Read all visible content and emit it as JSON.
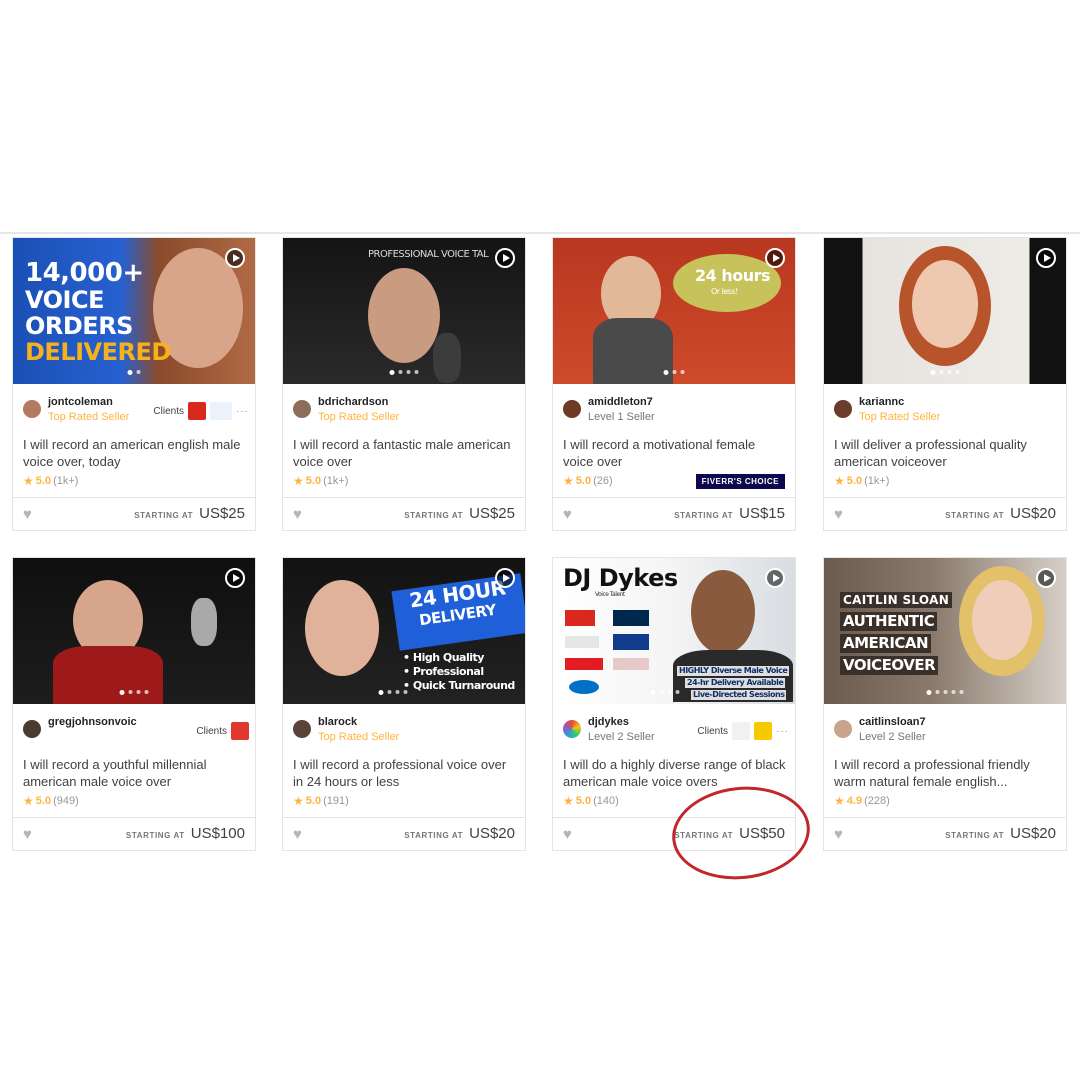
{
  "gigs": [
    {
      "username": "jontcoleman",
      "level": "Top Rated Seller",
      "clients_label": "Clients",
      "title": "I will record an american english male voice over, today",
      "rating": "5.0",
      "reviews": "(1k+)",
      "starting_label": "STARTING AT",
      "price": "US$25",
      "thumb_lines": [
        "14,000+",
        "VOICE",
        "ORDERS",
        "DELIVERED"
      ]
    },
    {
      "username": "bdrichardson",
      "level": "Top Rated Seller",
      "title": "I will record a fantastic male american voice over",
      "rating": "5.0",
      "reviews": "(1k+)",
      "starting_label": "STARTING AT",
      "price": "US$25",
      "thumb_lines": [
        "PROFESSIONAL VOICE TAL"
      ]
    },
    {
      "username": "amiddleton7",
      "level": "Level 1 Seller",
      "title": "I will record a motivational female voice over",
      "rating": "5.0",
      "reviews": "(26)",
      "badge": "FIVERR'S CHOICE",
      "starting_label": "STARTING AT",
      "price": "US$15",
      "thumb_lines": [
        "24 hours",
        "Or less!"
      ]
    },
    {
      "username": "kariannc",
      "level": "Top Rated Seller",
      "title": "I will deliver a professional quality american voiceover",
      "rating": "5.0",
      "reviews": "(1k+)",
      "starting_label": "STARTING AT",
      "price": "US$20"
    },
    {
      "username": "gregjohnsonvoic",
      "level": "",
      "clients_label": "Clients",
      "title": "I will record a youthful millennial american male voice over",
      "rating": "5.0",
      "reviews": "(949)",
      "starting_label": "STARTING AT",
      "price": "US$100"
    },
    {
      "username": "blarock",
      "level": "Top Rated Seller",
      "title": "I will record a professional voice over in 24 hours or less",
      "rating": "5.0",
      "reviews": "(191)",
      "starting_label": "STARTING AT",
      "price": "US$20",
      "thumb_lines": [
        "24 HOUR",
        "DELIVERY",
        "• High Quality",
        "• Professional",
        "• Quick Turnaround"
      ]
    },
    {
      "username": "djdykes",
      "level": "Level 2 Seller",
      "clients_label": "Clients",
      "title": "I will do a highly diverse range of black american male voice overs",
      "rating": "5.0",
      "reviews": "(140)",
      "starting_label": "STARTING AT",
      "price": "US$50",
      "thumb_lines": [
        "DJ Dykes",
        "Voice Talent",
        "HIGHLY Diverse Male Voice",
        "24-hr Delivery Available",
        "Live-Directed Sessions"
      ]
    },
    {
      "username": "caitlinsloan7",
      "level": "Level 2 Seller",
      "title": "I will record a professional friendly warm natural female english...",
      "rating": "4.9",
      "reviews": "(228)",
      "starting_label": "STARTING AT",
      "price": "US$20",
      "thumb_lines": [
        "CAITLIN SLOAN",
        "AUTHENTIC",
        "AMERICAN",
        "VOICEOVER"
      ]
    }
  ],
  "colors": {
    "top_rated": "#ffb33e",
    "annotation": "#c0262b",
    "choice_badge": "#0d084d"
  },
  "icons": {
    "play": "play-icon",
    "heart": "heart-icon",
    "star": "star-icon"
  }
}
